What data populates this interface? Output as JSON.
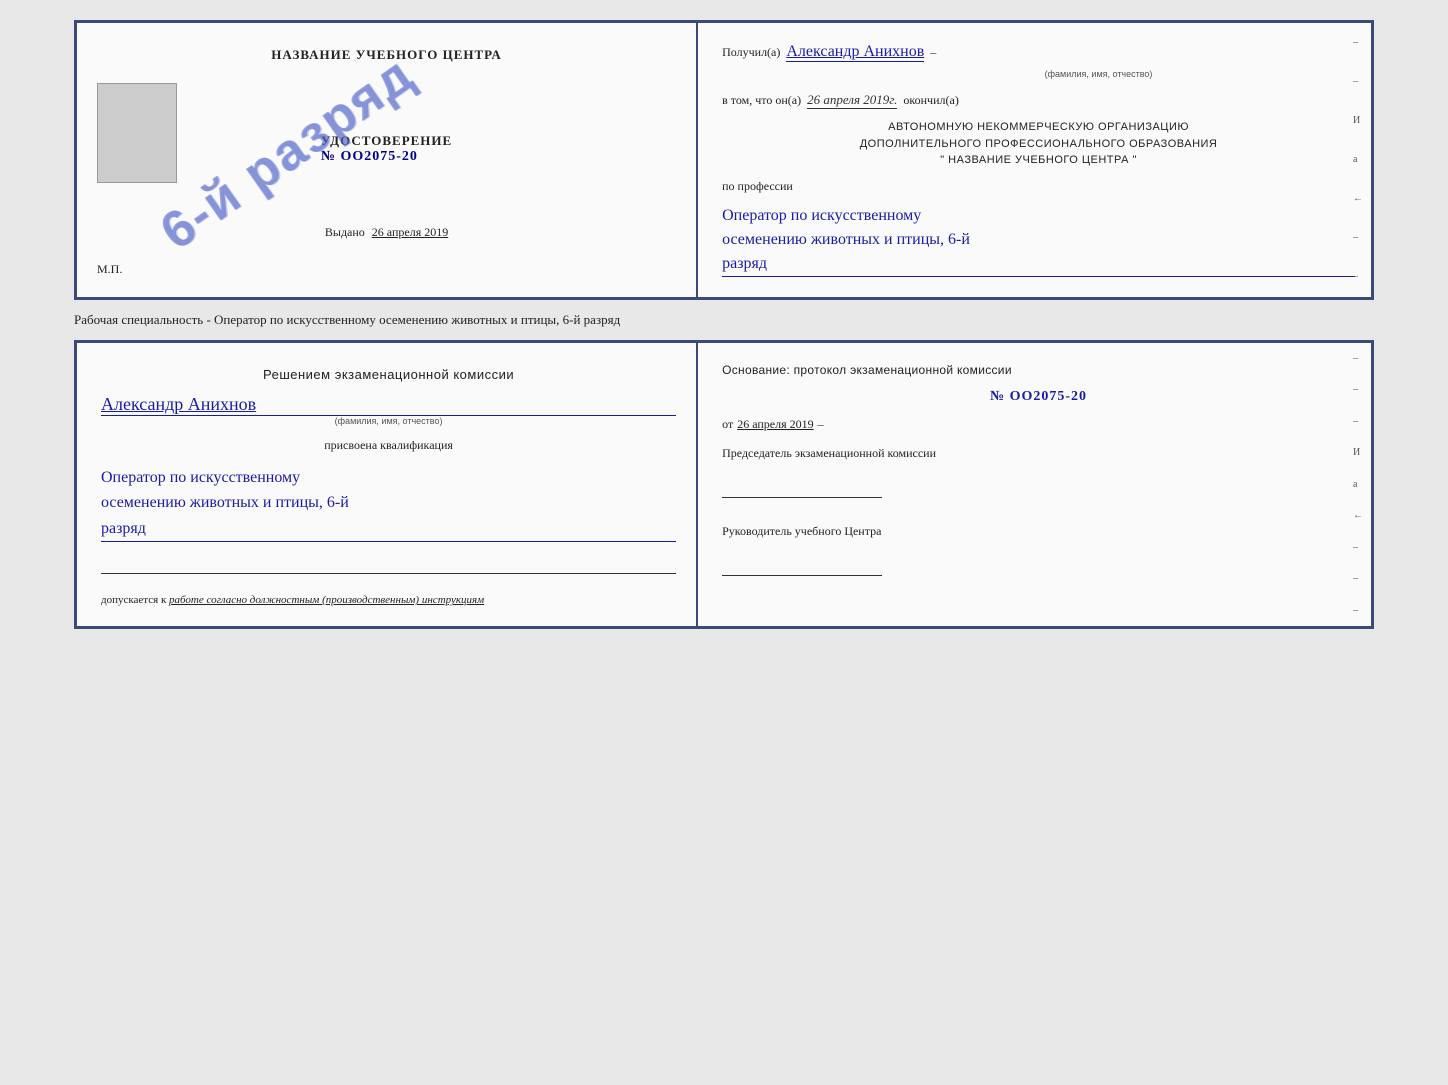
{
  "page": {
    "background": "#e8e8e8"
  },
  "top_cert": {
    "left": {
      "org_name": "НАЗВАНИЕ УЧЕБНОГО ЦЕНТРА",
      "cert_title": "УДОСТОВЕРЕНИЕ",
      "cert_number": "№ OO2075-20",
      "issued_label": "Выдано",
      "issued_date": "26 апреля 2019",
      "mp": "М.П.",
      "stamp_text": "6-й разряд"
    },
    "right": {
      "received_label": "Получил(а)",
      "received_name": "Александр Анихнов",
      "name_subtitle": "(фамилия, имя, отчество)",
      "dash1": "–",
      "date_intro": "в том, что он(а)",
      "date_value": "26 апреля 2019г.",
      "finished": "окончил(а)",
      "org_line1": "АВТОНОМНУЮ НЕКОММЕРЧЕСКУЮ ОРГАНИЗАЦИЮ",
      "org_line2": "ДОПОЛНИТЕЛЬНОГО ПРОФЕССИОНАЛЬНОГО ОБРАЗОВАНИЯ",
      "org_line3": "\"   НАЗВАНИЕ УЧЕБНОГО ЦЕНТРА   \"",
      "profession_label": "по профессии",
      "profession_line1": "Оператор по искусственному",
      "profession_line2": "осеменению животных и птицы, 6-й",
      "profession_line3": "разряд"
    }
  },
  "middle_label": "Рабочая специальность - Оператор по искусственному осеменению животных и птицы, 6-й разряд",
  "bottom_cert": {
    "left": {
      "decision_title": "Решением экзаменационной комиссии",
      "person_name": "Александр Анихнов",
      "name_subtitle": "(фамилия, имя, отчество)",
      "qualification_label": "присвоена квалификация",
      "qualification_line1": "Оператор по искусственному",
      "qualification_line2": "осеменению животных и птицы, 6-й",
      "qualification_line3": "разряд",
      "admitted_intro": "допускается к",
      "admitted_text": "работе согласно должностным (производственным) инструкциям"
    },
    "right": {
      "basis_label": "Основание: протокол экзаменационной комиссии",
      "protocol_number": "№  OO2075-20",
      "date_from_label": "от",
      "date_from_value": "26 апреля 2019",
      "chairman_label": "Председатель экзаменационной комиссии",
      "director_label": "Руководитель учебного Центра"
    }
  },
  "dashes": [
    "-",
    "-",
    "-",
    "-",
    "И",
    "а",
    "←",
    "-",
    "-",
    "-",
    "-",
    "-"
  ],
  "dashes_bottom": [
    "-",
    "-",
    "-",
    "-",
    "-",
    "И",
    "а",
    "←",
    "-",
    "-",
    "-",
    "-",
    "-"
  ]
}
